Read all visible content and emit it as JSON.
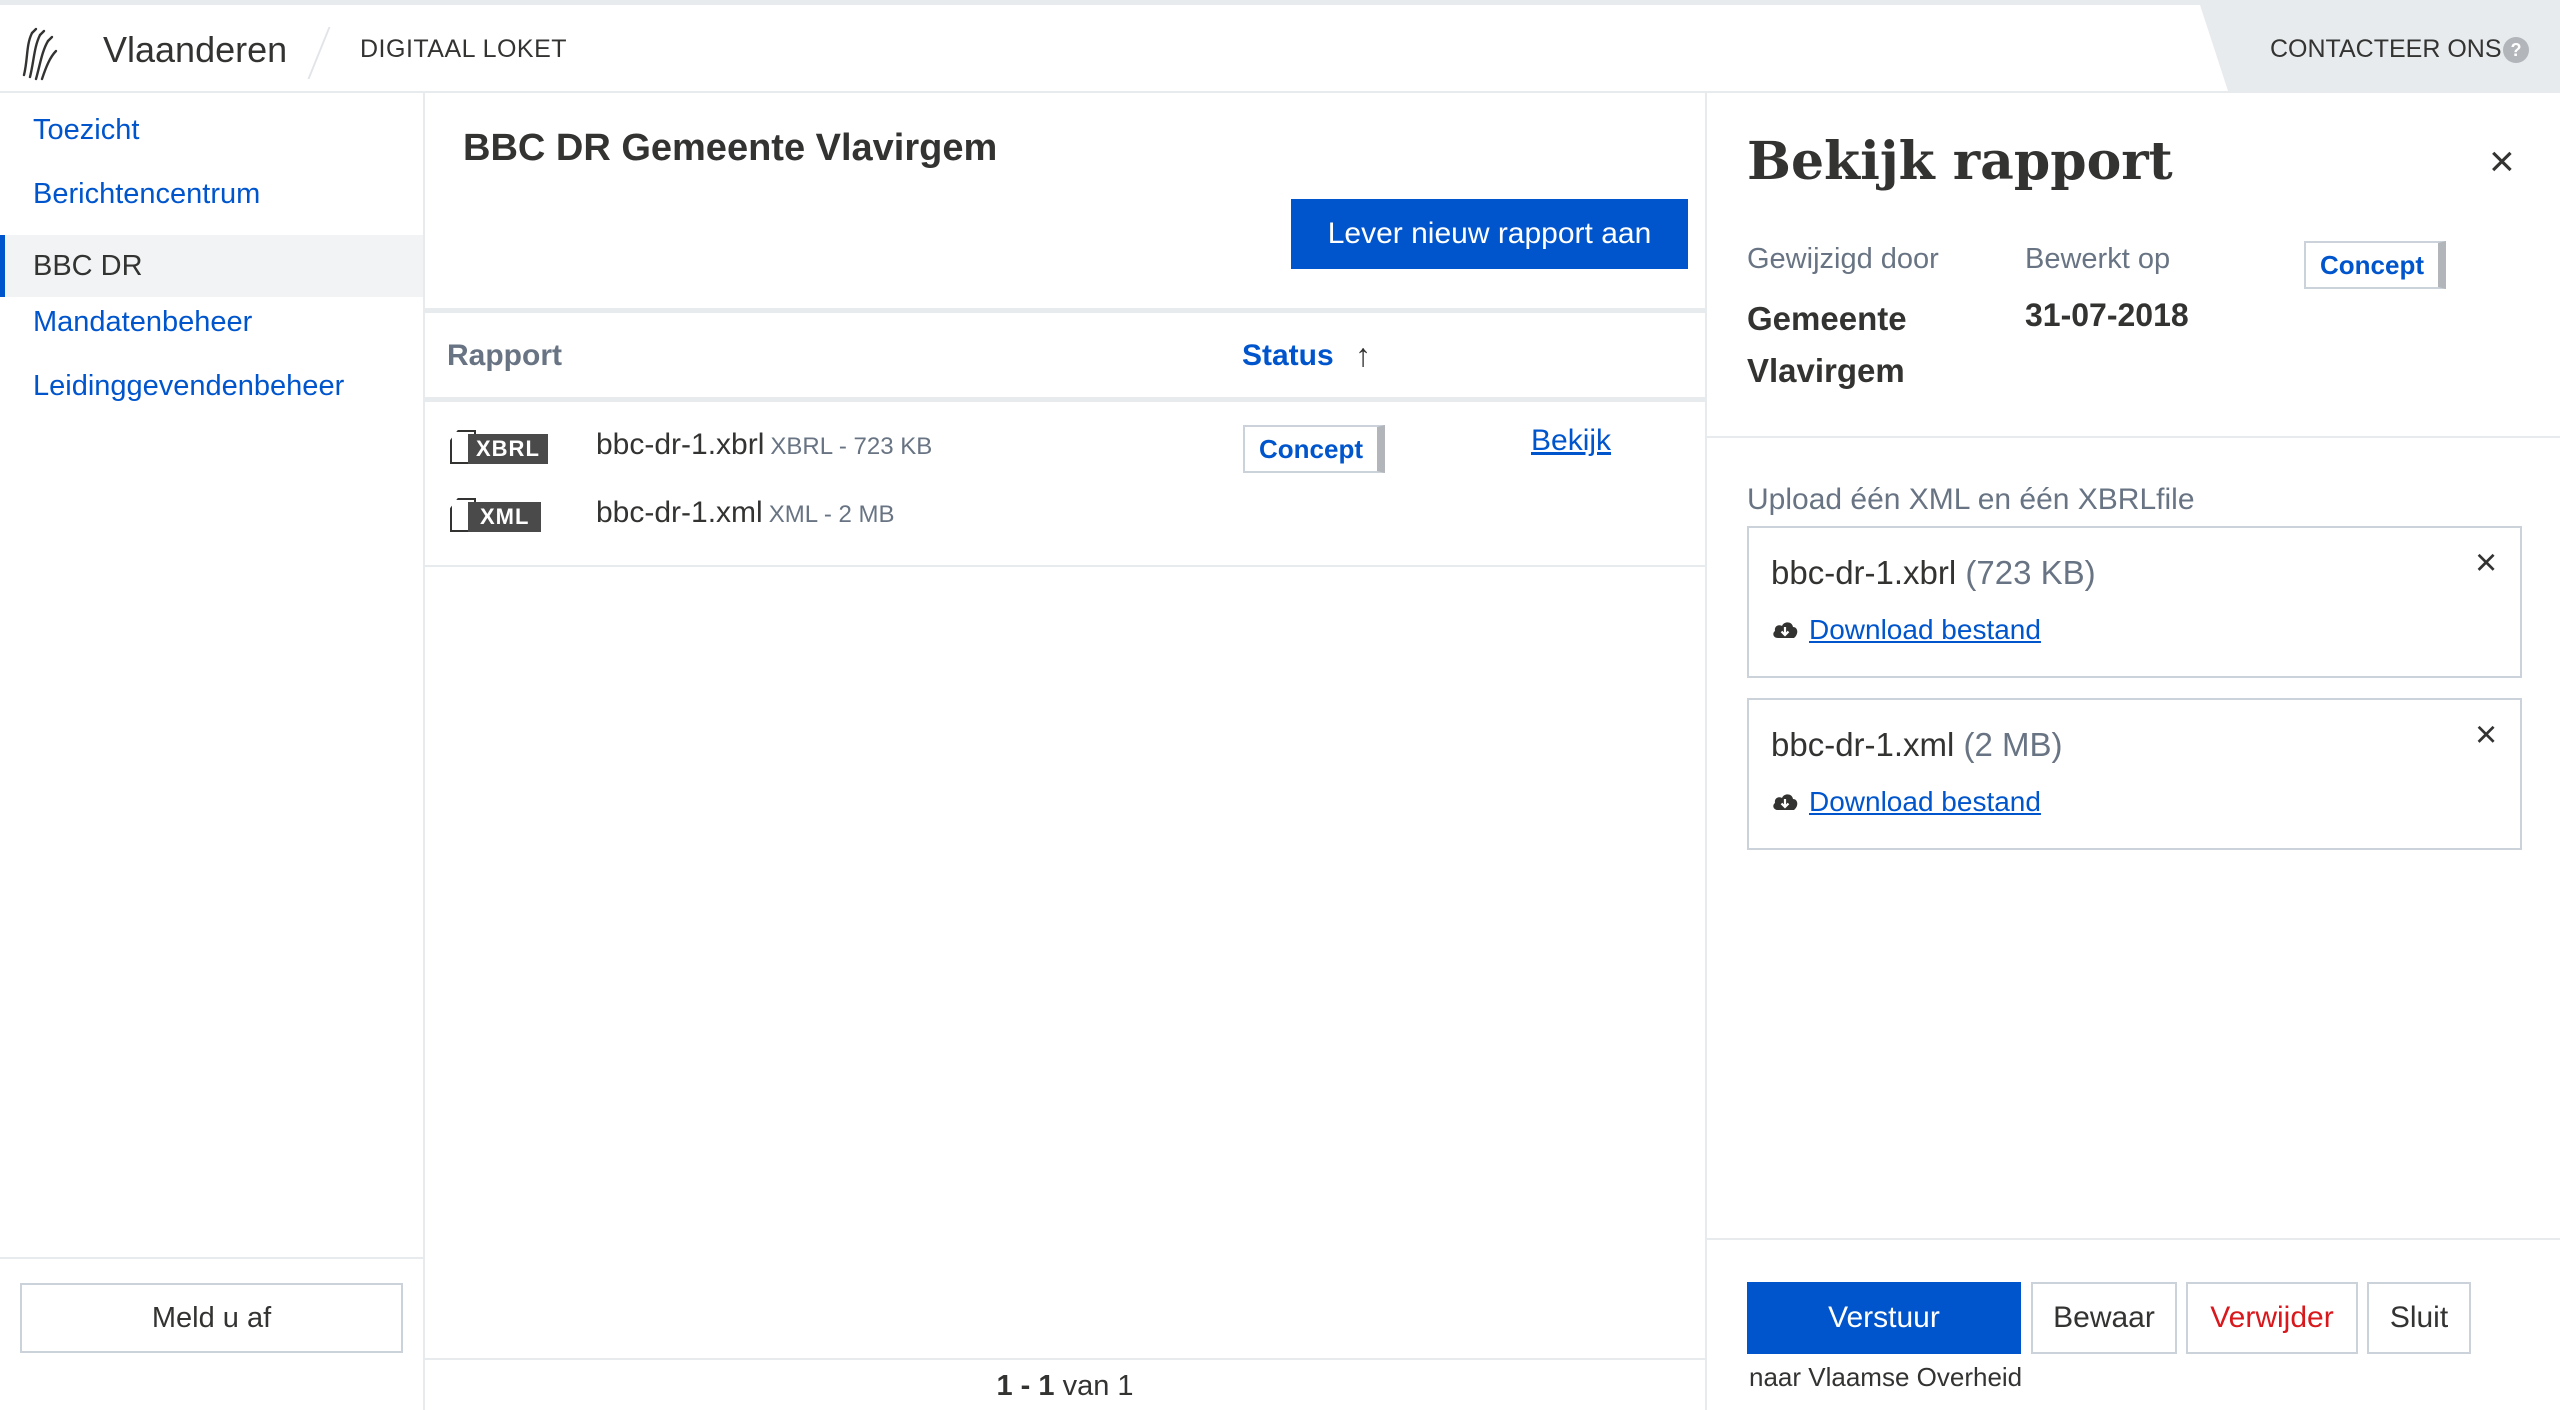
{
  "header": {
    "brand": "Vlaanderen",
    "loket": "DIGITAAL LOKET",
    "contact": "CONTACTEER ONS",
    "help_glyph": "?"
  },
  "sidebar": {
    "items": [
      {
        "label": "Toezicht",
        "active": false
      },
      {
        "label": "Berichtencentrum",
        "active": false
      },
      {
        "label": "BBC DR",
        "active": true
      },
      {
        "label": "Mandatenbeheer",
        "active": false
      },
      {
        "label": "Leidinggevendenbeheer",
        "active": false
      }
    ],
    "logout": "Meld u af"
  },
  "main": {
    "title": "BBC DR Gemeente Vlavirgem",
    "new_button": "Lever nieuw rapport aan",
    "columns": {
      "rapport": "Rapport",
      "status": "Status",
      "sort_glyph": "↑"
    },
    "rows": [
      {
        "files": [
          {
            "badge": "XBRL",
            "name": "bbc-dr-1.xbrl",
            "meta": "XBRL - 723 KB"
          },
          {
            "badge": "XML",
            "name": "bbc-dr-1.xml",
            "meta": "XML - 2 MB"
          }
        ],
        "status": "Concept",
        "action": "Bekijk"
      }
    ],
    "pager": {
      "range": "1 - 1",
      "suffix": "van 1"
    }
  },
  "panel": {
    "title": "Bekijk rapport",
    "close_glyph": "×",
    "modified_by_label": "Gewijzigd door",
    "modified_by_line1": "Gemeente",
    "modified_by_line2": "Vlavirgem",
    "edited_on_label": "Bewerkt op",
    "edited_on": "31-07-2018",
    "status": "Concept",
    "upload_label": "Upload één XML en één XBRLfile",
    "files": [
      {
        "name": "bbc-dr-1.xbrl",
        "size": "(723 KB)",
        "download": "Download bestand"
      },
      {
        "name": "bbc-dr-1.xml",
        "size": "(2 MB)",
        "download": "Download bestand"
      }
    ],
    "buttons": {
      "send": "Verstuur",
      "save": "Bewaar",
      "delete": "Verwijder",
      "close": "Sluit"
    },
    "send_note": "naar Vlaamse Overheid"
  },
  "colors": {
    "primary": "#0055cc",
    "danger": "#d8181c",
    "border": "#cbd2da",
    "muted": "#687483"
  },
  "icons": [
    "flemish-lion-logo-icon",
    "help-icon",
    "sort-ascending-icon",
    "file-icon",
    "close-icon",
    "cloud-download-icon"
  ]
}
